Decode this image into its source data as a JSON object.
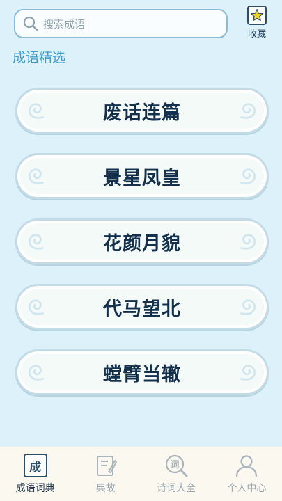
{
  "search": {
    "placeholder": "搜索成语",
    "icon": "search-icon"
  },
  "favorites": {
    "label": "收藏",
    "icon": "star-icon",
    "star_color": "#f5d21c"
  },
  "section": {
    "title": "成语精选"
  },
  "idioms": [
    "废话连篇",
    "景星凤皇",
    "花颜月貌",
    "代马望北",
    "螳臂当辙"
  ],
  "tabs": [
    {
      "label": "成语词典",
      "icon_char": "成",
      "active": true
    },
    {
      "label": "典故",
      "icon": "book-pen-icon",
      "active": false
    },
    {
      "label": "诗词大全",
      "icon_char": "词",
      "active": false
    },
    {
      "label": "个人中心",
      "icon": "person-icon",
      "active": false
    }
  ],
  "colors": {
    "accent": "#3d9bd0",
    "background": "#dcf1f9",
    "text_dark": "#13314d"
  }
}
